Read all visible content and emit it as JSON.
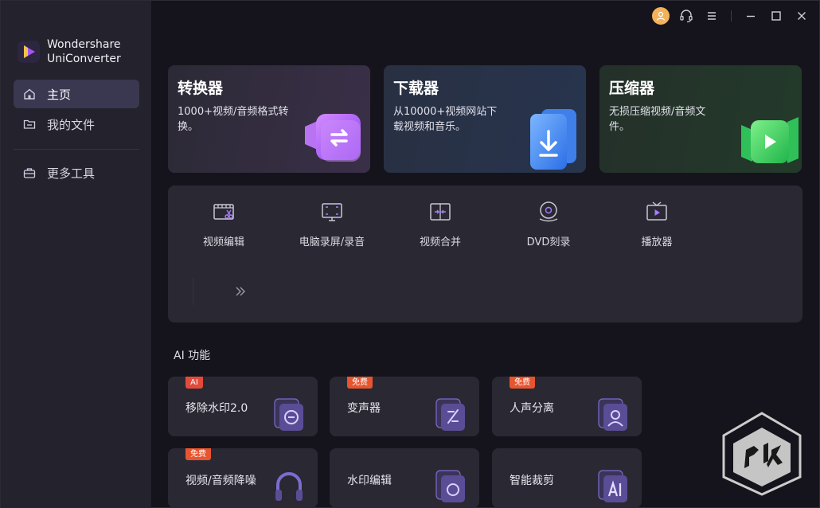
{
  "app": {
    "name_line1": "Wondershare",
    "name_line2": "UniConverter"
  },
  "sidebar": {
    "items": [
      {
        "label": "主页",
        "icon": "home-icon",
        "active": true
      },
      {
        "label": "我的文件",
        "icon": "folder-icon",
        "active": false
      },
      {
        "label": "更多工具",
        "icon": "toolbox-icon",
        "active": false
      }
    ]
  },
  "features": [
    {
      "title": "转换器",
      "desc": "1000+视频/音频格式转换。",
      "icon": "convert-icon"
    },
    {
      "title": "下载器",
      "desc": "从10000+视频网站下载视频和音乐。",
      "icon": "download-icon"
    },
    {
      "title": "压缩器",
      "desc": "无损压缩视频/音频文件。",
      "icon": "compress-icon"
    }
  ],
  "tools": [
    {
      "label": "视频编辑",
      "icon": "video-edit-icon"
    },
    {
      "label": "电脑录屏/录音",
      "icon": "screen-record-icon"
    },
    {
      "label": "视频合并",
      "icon": "video-merge-icon"
    },
    {
      "label": "DVD刻录",
      "icon": "dvd-burn-icon"
    },
    {
      "label": "播放器",
      "icon": "player-icon"
    }
  ],
  "ai_section": {
    "title": "AI 功能",
    "cards": [
      {
        "label": "移除水印2.0",
        "badge": "AI",
        "icon": "watermark-remove-icon"
      },
      {
        "label": "变声器",
        "badge": "免费",
        "icon": "voice-changer-icon"
      },
      {
        "label": "人声分离",
        "badge": "免费",
        "icon": "vocal-separation-icon"
      },
      {
        "label": "视频/音频降噪",
        "badge": "免费",
        "icon": "noise-reduction-icon"
      },
      {
        "label": "水印编辑",
        "badge": "",
        "icon": "watermark-edit-icon"
      },
      {
        "label": "智能裁剪",
        "badge": "",
        "icon": "smart-crop-icon"
      }
    ]
  },
  "colors": {
    "background": "#15141c",
    "sidebar": "#23222d",
    "card": "#2a2933",
    "accent_purple": "#8a5cf6",
    "badge_red": "#e34a3b",
    "avatar": "#f2b25c"
  }
}
